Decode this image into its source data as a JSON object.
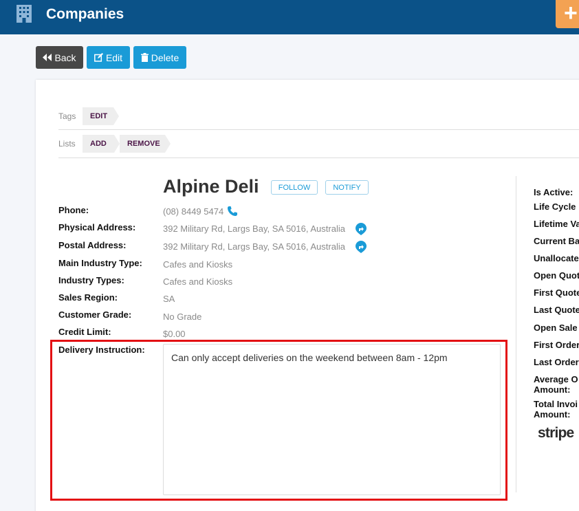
{
  "header": {
    "title": "Companies",
    "add_label": "+"
  },
  "toolbar": {
    "back_label": "Back",
    "edit_label": "Edit",
    "delete_label": "Delete"
  },
  "tags": {
    "label": "Tags",
    "edit_label": "EDIT"
  },
  "lists": {
    "label": "Lists",
    "add_label": "ADD",
    "remove_label": "REMOVE"
  },
  "company": {
    "name": "Alpine Deli",
    "follow_label": "FOLLOW",
    "notify_label": "NOTIFY"
  },
  "fields": [
    {
      "label": "Phone:",
      "value": "(08) 8449 5474"
    },
    {
      "label": "Physical Address:",
      "value": "392 Military Rd, Largs Bay, SA 5016, Australia"
    },
    {
      "label": "Postal Address:",
      "value": "392 Military Rd, Largs Bay, SA 5016, Australia"
    },
    {
      "label": "Main Industry Type:",
      "value": "Cafes and Kiosks"
    },
    {
      "label": "Industry Types:",
      "value": "Cafes and Kiosks"
    },
    {
      "label": "Sales Region:",
      "value": "SA"
    },
    {
      "label": "Customer Grade:",
      "value": "No Grade"
    },
    {
      "label": "Credit Limit:",
      "value": "$0.00"
    }
  ],
  "delivery": {
    "label": "Delivery Instruction:",
    "value": "Can only accept deliveries on the weekend between 8am - 12pm"
  },
  "right_panel": {
    "labels": [
      "Is Active:",
      "Life Cycle",
      "Lifetime Va",
      "Current Ba",
      "Unallocate",
      "Open Quot",
      "First Quote",
      "Last Quote",
      "Open Sale",
      "First Order",
      "Last Order",
      "Average O",
      "Amount:",
      "Total Invoi",
      "Amount:"
    ],
    "stripe_logo": "stripe"
  },
  "colors": {
    "header": "#0b5288",
    "accent": "#1a9bd7",
    "highlight": "#e30f13",
    "add_button": "#f3a253"
  }
}
